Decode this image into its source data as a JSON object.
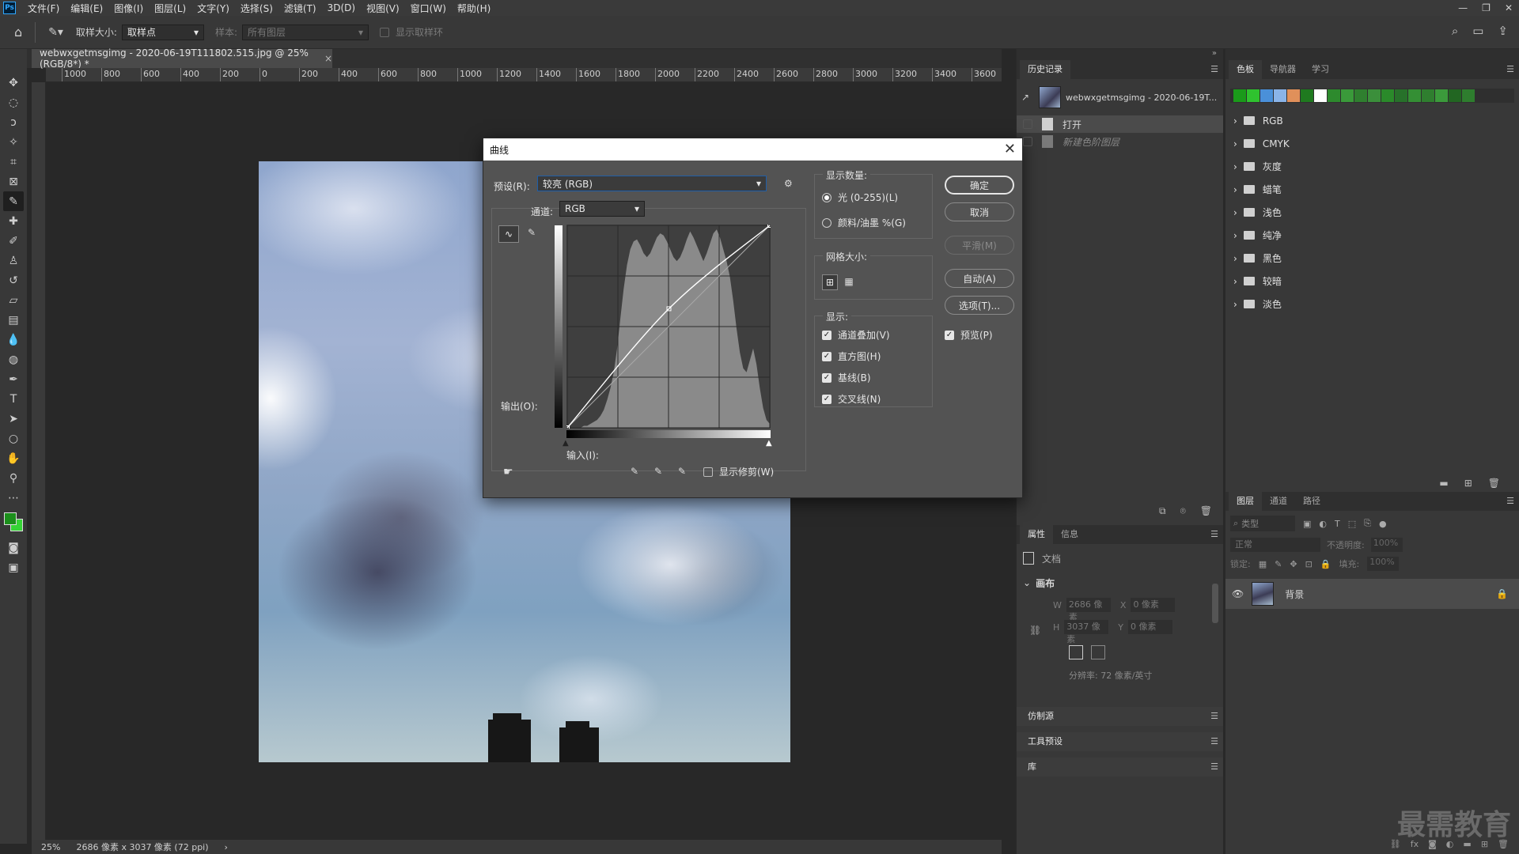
{
  "app": {
    "logo": "Ps"
  },
  "menu": [
    "文件(F)",
    "编辑(E)",
    "图像(I)",
    "图层(L)",
    "文字(Y)",
    "选择(S)",
    "滤镜(T)",
    "3D(D)",
    "视图(V)",
    "窗口(W)",
    "帮助(H)"
  ],
  "options_bar": {
    "sample_size_label": "取样大小:",
    "sample_size_value": "取样点",
    "sample_label": "样本:",
    "sample_value": "所有图层",
    "show_ring_label": "显示取样环"
  },
  "document": {
    "tab_title": "webwxgetmsgimg - 2020-06-19T111802.515.jpg @ 25%(RGB/8*) *",
    "ruler_ticks": [
      "1000",
      "800",
      "600",
      "400",
      "200",
      "0",
      "200",
      "400",
      "600",
      "800",
      "1000",
      "1200",
      "1400",
      "1600",
      "1800",
      "2000",
      "2200",
      "2400",
      "2600",
      "2800",
      "3000",
      "3200",
      "3400",
      "3600"
    ],
    "zoom": "25%",
    "size_info": "2686 像素 x 3037 像素 (72 ppi)"
  },
  "history_panel": {
    "tab": "历史记录",
    "snapshot": "webwxgetmsgimg - 2020-06-19T...",
    "items": [
      "打开",
      "新建色阶图层"
    ]
  },
  "properties_panel": {
    "tabs": [
      "属性",
      "信息"
    ],
    "doc_label": "文档",
    "section": "画布",
    "w_label": "W",
    "w_value": "2686 像素",
    "h_label": "H",
    "h_value": "3037 像素",
    "x_label": "X",
    "x_value": "0 像素",
    "y_label": "Y",
    "y_value": "0 像素",
    "resolution": "分辨率: 72 像素/英寸"
  },
  "collapsed_panels": [
    "仿制源",
    "工具预设",
    "库"
  ],
  "swatches_panel": {
    "tabs": [
      "色板",
      "导航器",
      "学习"
    ],
    "colors": [
      "#1a9a1a",
      "#2fc22f",
      "#4a90d9",
      "#8ab4e8",
      "#e0905a",
      "#1f7a1f",
      "#ffffff",
      "#2d8a2d",
      "#3a9a3a",
      "#2f7f2f",
      "#3b8f3b",
      "#2a8a2a",
      "#27712a",
      "#348f34",
      "#2f7e2f",
      "#3b9a3b",
      "#226622",
      "#2e7d2e"
    ],
    "groups": [
      "RGB",
      "CMYK",
      "灰度",
      "蜡笔",
      "浅色",
      "纯净",
      "黑色",
      "较暗",
      "淡色"
    ]
  },
  "layers_panel": {
    "tabs": [
      "图层",
      "通道",
      "路径"
    ],
    "filter_placeholder": "类型",
    "blend_mode": "正常",
    "opacity_label": "不透明度:",
    "opacity_value": "100%",
    "lock_label": "锁定:",
    "fill_label": "填充:",
    "fill_value": "100%",
    "layer_name": "背景"
  },
  "curves_dialog": {
    "title": "曲线",
    "preset_label": "预设(R):",
    "preset_value": "较亮 (RGB)",
    "channel_label": "通道:",
    "channel_value": "RGB",
    "output_label": "输出(O):",
    "input_label": "输入(I):",
    "show_clipping": "显示修剪(W)",
    "show_amount_title": "显示数量:",
    "light_option": "光 (0-255)(L)",
    "pigment_option": "颜料/油墨 %(G)",
    "grid_size_title": "网格大小:",
    "display_title": "显示:",
    "display_options": [
      "通道叠加(V)",
      "直方图(H)",
      "基线(B)",
      "交叉线(N)"
    ],
    "buttons": {
      "ok": "确定",
      "cancel": "取消",
      "smooth": "平滑(M)",
      "auto": "自动(A)",
      "options": "选项(T)..."
    },
    "preview": "预览(P)",
    "curve_points": [
      [
        0,
        0
      ],
      [
        128,
        150
      ],
      [
        255,
        255
      ]
    ],
    "histogram": [
      0,
      0,
      0,
      0,
      0,
      1,
      1,
      2,
      3,
      4,
      6,
      9,
      14,
      20,
      28,
      40,
      55,
      70,
      82,
      90,
      94,
      95,
      92,
      88,
      86,
      88,
      92,
      96,
      98,
      97,
      94,
      90,
      86,
      84,
      86,
      90,
      95,
      99,
      96,
      92,
      88,
      84,
      88,
      93,
      98,
      100,
      96,
      90,
      84,
      76,
      64,
      50,
      38,
      30,
      28,
      34,
      40,
      32,
      20,
      10,
      4,
      2
    ]
  },
  "watermark": "最需教育"
}
